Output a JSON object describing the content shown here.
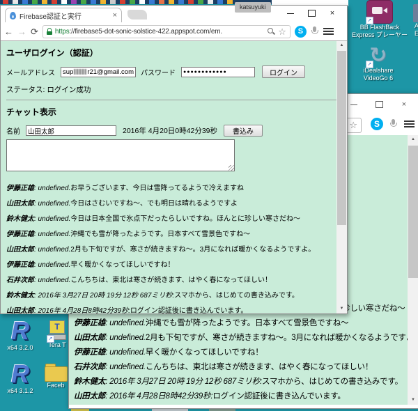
{
  "window1": {
    "tab": {
      "title": "Firebase認証と実行",
      "close": "×"
    },
    "profile": "katsuyuki",
    "controls": {
      "close": "×"
    },
    "toolbar": {
      "back": "←",
      "forward": "→",
      "reload": "⟳",
      "url_scheme": "https",
      "url_rest": "://firebase5-dot-sonic-solstice-422.appspot.com/em.",
      "star": "☆",
      "skype": "S"
    },
    "page": {
      "login_heading": "ユーザログイン（認証）",
      "email_label": "メールアドレス",
      "email_prefix": "sup",
      "email_suffix": "r21@gmail.com",
      "password_label": "パスワード",
      "password_masked": "●●●●●●●●●●●●",
      "login_button": "ログイン",
      "status": "ステータス: ログイン成功",
      "chat_heading": "チャット表示",
      "name_label": "名前",
      "name_value": "山田太郎",
      "datetime": "2016年 4月20日0時42分39秒",
      "write_button": "書込み"
    }
  },
  "window2": {
    "controls": {
      "close": "×"
    },
    "toolbar": {
      "star": "☆",
      "skype": "S"
    }
  },
  "messages": [
    {
      "name": "伊藤正雄",
      "tag": ": undefined.",
      "body": "お早うございます、今日は雪降ってるようで冷えますね"
    },
    {
      "name": "山田太郎",
      "tag": ": undefined.",
      "body": "今日はさむいですね～、でも明日は晴れるようですよ"
    },
    {
      "name": "鈴木健太",
      "tag": ": undefined.",
      "body": "今日は日本全国で氷点下だったらしいですね。ほんとに珍しい寒さだね～"
    },
    {
      "name": "伊藤正雄",
      "tag": ": undefined.",
      "body": "沖縄でも雪が降ったようです。日本すべて雪景色ですね～"
    },
    {
      "name": "山田太郎",
      "tag": ": undefined.",
      "body": "2月も下旬ですが、寒さが続きますね～。3月になれば暖かくなるようですよ。"
    },
    {
      "name": "伊藤正雄",
      "tag": ": undefined.",
      "body": "早く暖かくなってほしいですね！"
    },
    {
      "name": "石井次郎",
      "tag": ": undefined.",
      "body": "こんちちは、東北は寒さが続きます、はやく春になってほしい！"
    },
    {
      "name": "鈴木健太",
      "tag": ": 2016年 3月27日 20時 19分 12秒 687ミリ秒:",
      "body": "スマホから、はじめての書き込みです。"
    },
    {
      "name": "山田太郎",
      "tag": ": 2016年 4月28日8時42分39秒:",
      "body": "ログイン認証後に書き込んでいます。"
    }
  ],
  "desktop": {
    "icons": {
      "bb_flashback": {
        "label1": "BB FlashBack",
        "label2": "Express プレーヤー"
      },
      "idealshare": {
        "glyph": "↻",
        "label1": "iDealshare",
        "label2": "VideoGo 6"
      },
      "edge_partial": {
        "label1": "A",
        "label2": "E"
      },
      "r1": {
        "glyph": "R",
        "label": "x64 3.2.0"
      },
      "teraterm": {
        "glyph": "T",
        "label": "Tera T"
      },
      "r2": {
        "glyph": "R",
        "label": "x64 3.1.2"
      },
      "folder": {
        "label": "Faceb"
      }
    },
    "tab_strip_colors": [
      "#d54034",
      "#e8e8e8",
      "#3a7bd5",
      "#48a848",
      "#f2b632",
      "#d54034",
      "#ffffff",
      "#9a44b2",
      "#48a848",
      "#3a7bd5",
      "#f2b632",
      "#cccccc",
      "#d54034",
      "#48a848",
      "#ffffff",
      "#3a7bd5",
      "#e8734a",
      "#f2b632",
      "#3a7bd5",
      "#d54034",
      "#48a848",
      "#eeeeee",
      "#3a7bd5",
      "#f2b632"
    ],
    "colors": {
      "desktop_teal": "#1D96A6",
      "page_green": "#C9ECD9",
      "skype_blue": "#00AFF0",
      "padlock_green": "#188038",
      "bb_purple": "#8E2C66",
      "folder_yellow": "#EAC94F"
    },
    "icons_glyphs": {
      "scroll_up": "▲",
      "scroll_down": "▼"
    }
  }
}
